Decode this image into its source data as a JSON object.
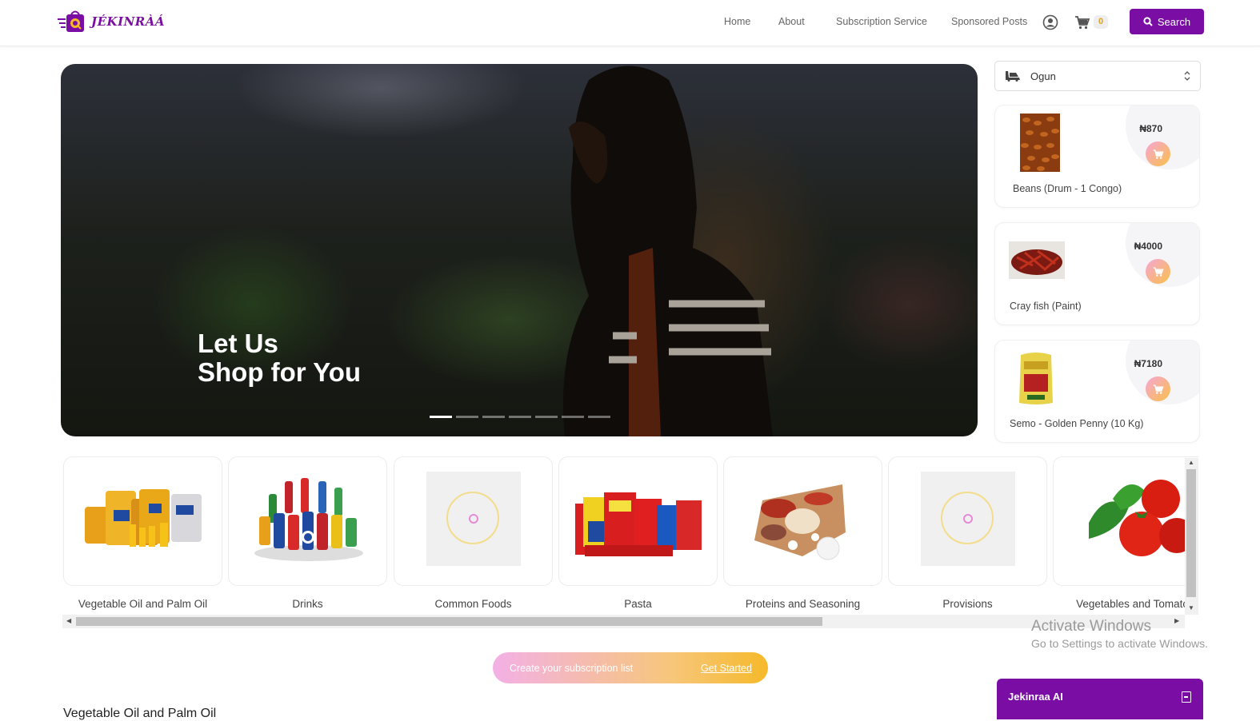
{
  "brand": {
    "name": "JÉKINRÀÁ"
  },
  "nav": {
    "links": [
      "Home",
      "About",
      "Subscription Service",
      "Sponsored Posts"
    ],
    "cart_count": "0",
    "search_label": "Search"
  },
  "hero": {
    "line1": "Let Us",
    "line2": "Shop for You",
    "slide_count": 7,
    "active_slide": 1
  },
  "location": {
    "selected": "Ogun"
  },
  "featured_products": [
    {
      "name": "Beans (Drum - 1 Congo)",
      "price": "₦870"
    },
    {
      "name": "Cray fish (Paint)",
      "price": "₦4000"
    },
    {
      "name": "Semo - Golden Penny (10 Kg)",
      "price": "₦7180"
    }
  ],
  "categories": [
    {
      "name": "Vegetable Oil and Palm Oil",
      "image": "oil-jerrycans"
    },
    {
      "name": "Drinks",
      "image": "soft-drinks"
    },
    {
      "name": "Common Foods",
      "image": "placeholder"
    },
    {
      "name": "Pasta",
      "image": "pasta-packs"
    },
    {
      "name": "Proteins and Seasoning",
      "image": "meat-chicken"
    },
    {
      "name": "Provisions",
      "image": "placeholder"
    },
    {
      "name": "Vegetables and Tomato",
      "image": "tomatoes"
    }
  ],
  "subscription": {
    "text": "Create your subscription list",
    "cta": "Get Started"
  },
  "section_heading": "Vegetable Oil and Palm Oil",
  "os_watermark": {
    "line1": "Activate Windows",
    "line2": "Go to Settings to activate Windows."
  },
  "assistant": {
    "title": "Jekinraa AI"
  },
  "colors": {
    "brand_purple": "#7a0da3",
    "accent_orange": "#f6b92a",
    "accent_pink": "#f3b0e6"
  }
}
